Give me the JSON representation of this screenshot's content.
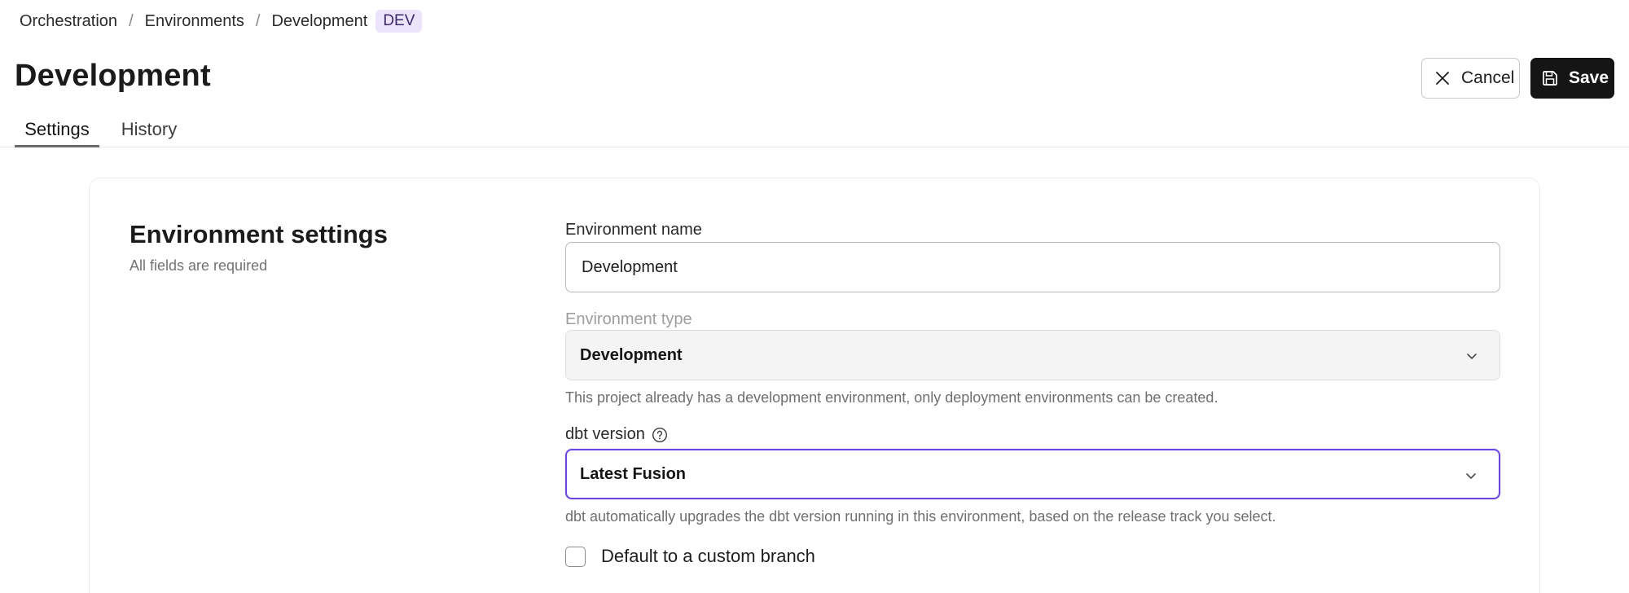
{
  "breadcrumb": {
    "items": [
      "Orchestration",
      "Environments",
      "Development"
    ],
    "separator": "/",
    "badge": "DEV"
  },
  "page": {
    "title": "Development"
  },
  "actions": {
    "cancel_label": "Cancel",
    "save_label": "Save"
  },
  "tabs": [
    {
      "label": "Settings",
      "active": true
    },
    {
      "label": "History",
      "active": false
    }
  ],
  "settings": {
    "title": "Environment settings",
    "subtitle": "All fields are required",
    "env_name": {
      "label": "Environment name",
      "value": "Development"
    },
    "env_type": {
      "label": "Environment type",
      "value": "Development",
      "disabled": true,
      "help": "This project already has a development environment, only deployment environments can be created."
    },
    "dbt_version": {
      "label": "dbt version",
      "value": "Latest Fusion",
      "help": "dbt automatically upgrades the dbt version running in this environment, based on the release track you select."
    },
    "custom_branch": {
      "label": "Default to a custom branch",
      "checked": false
    }
  },
  "icons": {
    "cancel": "close-icon",
    "save": "save-icon",
    "help": "question-circle-icon",
    "dropdown": "chevron-down-icon"
  },
  "colors": {
    "accent": "#6b46e0",
    "badge_bg": "#ebe4fb",
    "save_bg": "#151515"
  }
}
